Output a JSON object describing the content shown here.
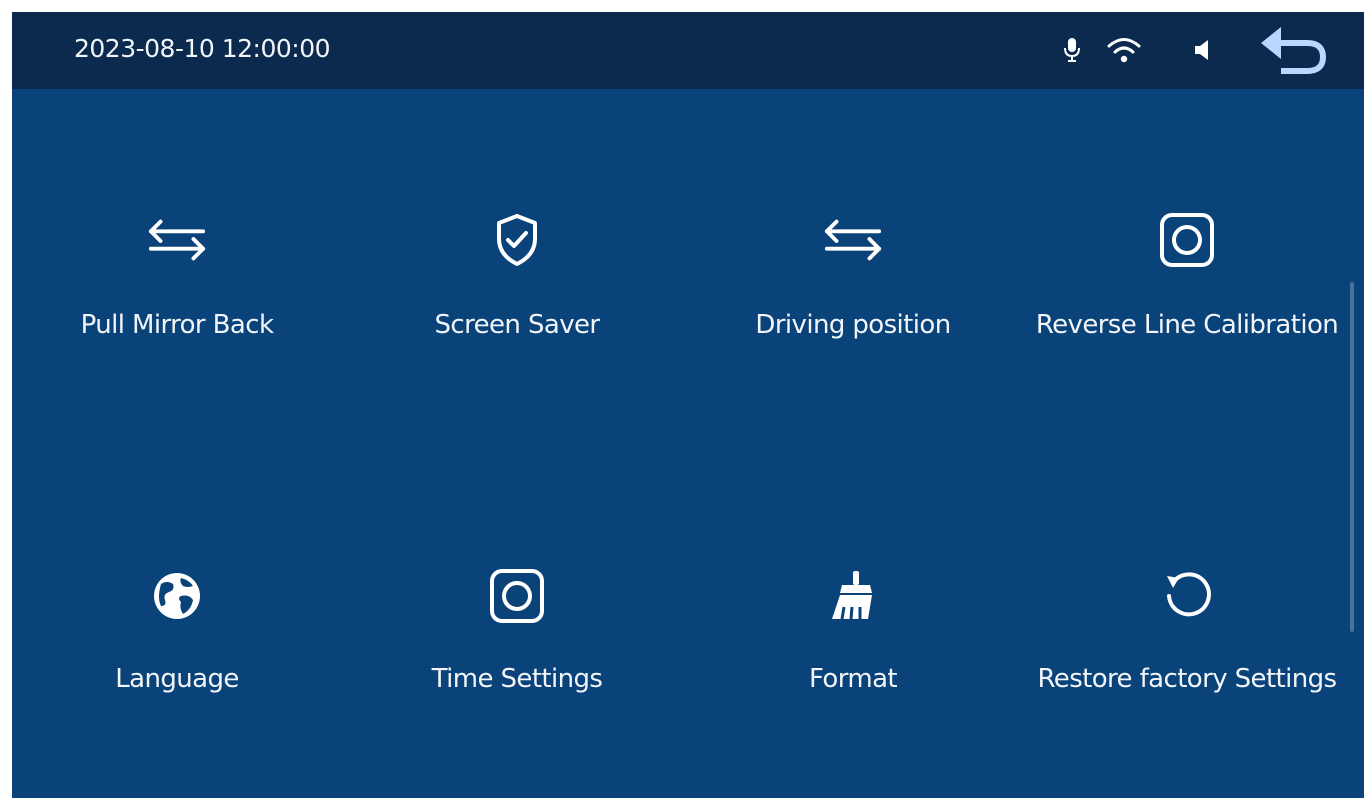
{
  "status_bar": {
    "datetime": "2023-08-10 12:00:00",
    "icons": [
      "mic-icon",
      "wifi-icon",
      "volume-icon",
      "back-icon"
    ]
  },
  "menu": {
    "items": [
      {
        "label": "Pull Mirror Back",
        "icon": "swap-arrows-icon"
      },
      {
        "label": "Screen Saver",
        "icon": "shield-check-icon"
      },
      {
        "label": "Driving position",
        "icon": "swap-arrows-icon"
      },
      {
        "label": "Reverse Line Calibration",
        "icon": "camera-lens-icon"
      },
      {
        "label": "Language",
        "icon": "globe-icon"
      },
      {
        "label": "Time Settings",
        "icon": "camera-lens-icon"
      },
      {
        "label": "Format",
        "icon": "broom-icon"
      },
      {
        "label": "Restore factory Settings",
        "icon": "restore-icon"
      }
    ]
  },
  "colors": {
    "background": "#0a4379",
    "status_bar": "#0b2a4d",
    "text": "#f2f5f9",
    "back_icon": "#bcd7ff"
  }
}
